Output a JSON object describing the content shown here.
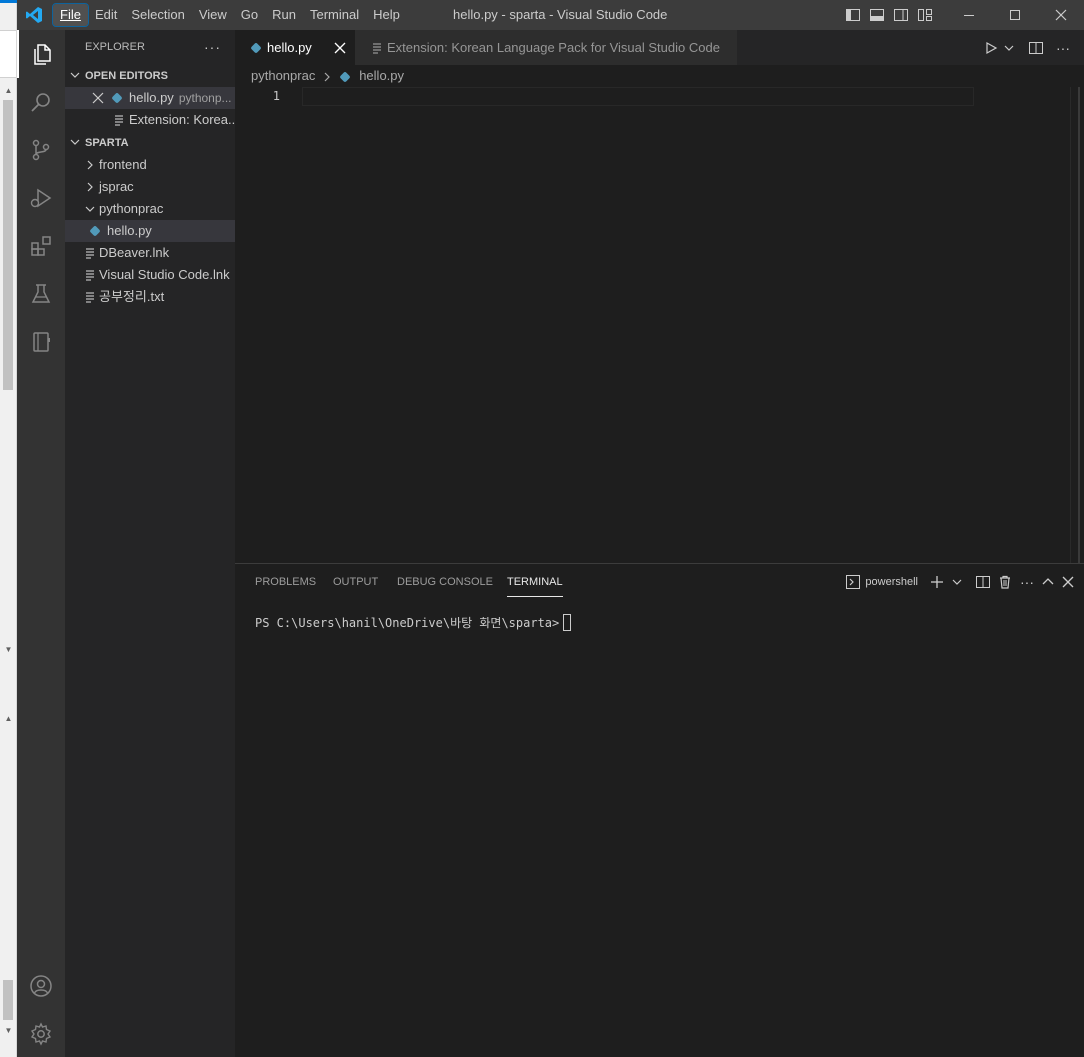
{
  "window": {
    "title": "hello.py - sparta - Visual Studio Code",
    "menu": [
      "File",
      "Edit",
      "Selection",
      "View",
      "Go",
      "Run",
      "Terminal",
      "Help"
    ],
    "active_menu": "File"
  },
  "colors": {
    "titlebar": "#3c3c3c",
    "activitybar": "#333333",
    "sidebar": "#252526",
    "editor": "#1e1e1e",
    "accent": "#0e639c",
    "python_icon": "#519aba"
  },
  "activity_bar": {
    "items": [
      "explorer-icon",
      "search-icon",
      "source-control-icon",
      "run-debug-icon",
      "extensions-icon",
      "testing-icon",
      "notebook-icon"
    ],
    "bottom": [
      "account-icon",
      "manage-gear-icon"
    ]
  },
  "sidebar": {
    "title": "EXPLORER",
    "more": "···",
    "open_editors": {
      "title": "OPEN EDITORS",
      "items": [
        {
          "name": "hello.py",
          "desc": "pythonp...",
          "icon": "python-file-icon"
        },
        {
          "name": "Extension: Korea...",
          "desc": "",
          "icon": "file-text-icon"
        }
      ]
    },
    "workspace": {
      "title": "SPARTA",
      "items": [
        {
          "name": "frontend",
          "type": "folder"
        },
        {
          "name": "jsprac",
          "type": "folder"
        },
        {
          "name": "pythonprac",
          "type": "folder-open"
        },
        {
          "name": "hello.py",
          "type": "python-file"
        },
        {
          "name": "DBeaver.lnk",
          "type": "file"
        },
        {
          "name": "Visual Studio Code.lnk",
          "type": "file"
        },
        {
          "name": "공부정리.txt",
          "type": "file"
        }
      ]
    }
  },
  "editor": {
    "tabs": [
      {
        "label": "hello.py",
        "active": true
      },
      {
        "label": "Extension: Korean Language Pack for Visual Studio Code",
        "active": false
      }
    ],
    "breadcrumb": [
      "pythonprac",
      "hello.py"
    ],
    "line_numbers": [
      "1"
    ]
  },
  "panel": {
    "tabs": [
      "PROBLEMS",
      "OUTPUT",
      "DEBUG CONSOLE",
      "TERMINAL"
    ],
    "active_tab": "TERMINAL",
    "shell": "powershell",
    "terminal_prompt": "PS C:\\Users\\hanil\\OneDrive\\바탕 화면\\sparta>"
  }
}
